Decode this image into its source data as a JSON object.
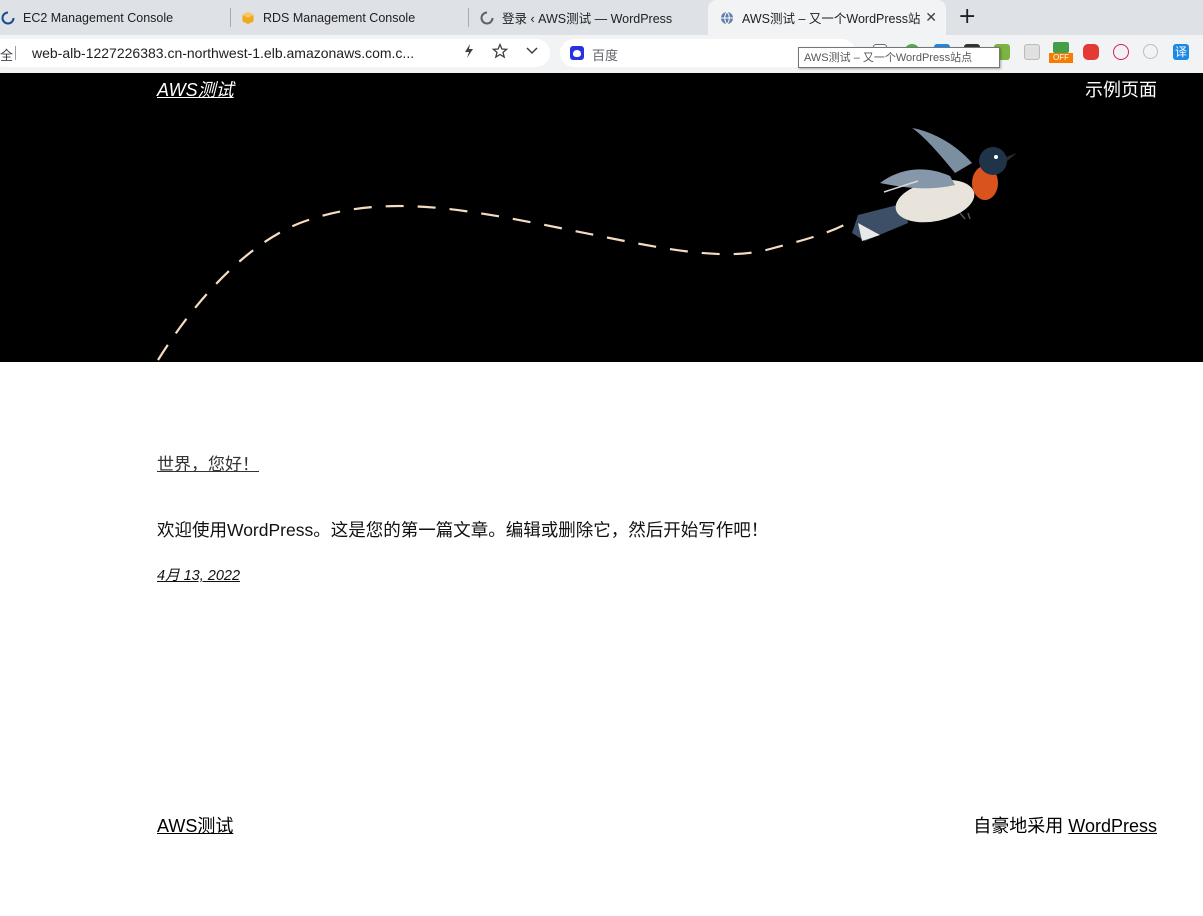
{
  "browser": {
    "tabs": [
      {
        "title": "EC2 Management Console",
        "icon": "loading-spinner-icon"
      },
      {
        "title": "RDS Management Console",
        "icon": "aws-cube-icon"
      },
      {
        "title": "登录 ‹ AWS测试 — WordPress",
        "icon": "loading-spinner-icon"
      },
      {
        "title": "AWS测试 – 又一个WordPress站",
        "icon": "globe-icon"
      }
    ],
    "new_tab": "+",
    "close": "✕",
    "address_secure": "全",
    "address_url": "web-alb-1227226383.cn-northwest-1.elb.amazonaws.com.c...",
    "search_placeholder": "百度",
    "tooltip": "AWS测试 – 又一个WordPress站点",
    "translate_label": "译",
    "off_badge": "OFF"
  },
  "site": {
    "title": "AWS测试",
    "nav": [
      "示例页面"
    ]
  },
  "post": {
    "title": "世界，您好！",
    "body": "欢迎使用WordPress。这是您的第一篇文章。编辑或删除它，然后开始写作吧！",
    "date": "4月 13, 2022"
  },
  "footer": {
    "site_name": "AWS测试",
    "powered_prefix": "自豪地采用 ",
    "powered_link": "WordPress"
  }
}
